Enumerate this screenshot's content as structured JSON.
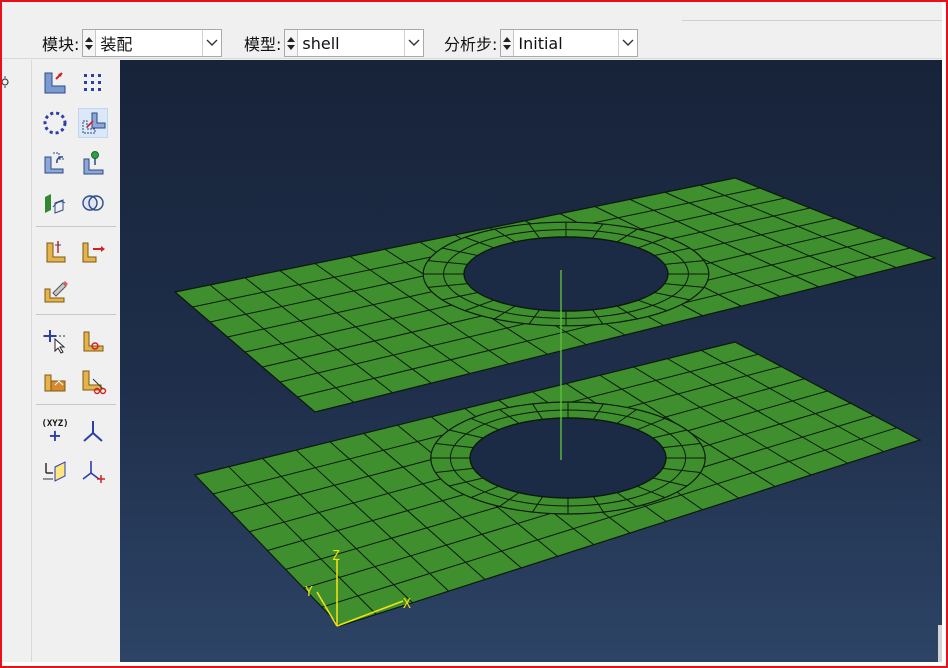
{
  "toolbar": {
    "module": {
      "label": "模块:",
      "value": "装配"
    },
    "model": {
      "label": "模型:",
      "value": "shell"
    },
    "step": {
      "label": "分析步:",
      "value": "Initial"
    }
  },
  "viewport": {
    "axis_labels": {
      "x": "X",
      "y": "Y",
      "z": "Z"
    }
  },
  "tools": [
    {
      "name": "instance-part-icon"
    },
    {
      "name": "linear-pattern-icon"
    },
    {
      "name": "radial-pattern-icon"
    },
    {
      "name": "translate-instance-icon"
    },
    {
      "name": "rotate-instance-icon"
    },
    {
      "name": "translate-to-icon"
    },
    {
      "name": "convert-constraints-icon"
    },
    {
      "name": "merge-cut-icon"
    },
    {
      "name": "parallel-face-icon"
    },
    {
      "name": "face-to-face-icon"
    },
    {
      "name": "edit-feature-icon"
    },
    {
      "name": "query-pick-icon"
    },
    {
      "name": "datum-point-icon"
    },
    {
      "name": "partition-cell-icon"
    },
    {
      "name": "cut-feature-icon"
    },
    {
      "name": "create-datum-xyz-icon",
      "label": "(XYZ)"
    },
    {
      "name": "datum-axis-icon"
    },
    {
      "name": "datum-plane-icon"
    },
    {
      "name": "datum-csys-icon"
    }
  ],
  "colors": {
    "frame": "#e8101a",
    "mesh_fill": "#3f8f2f",
    "mesh_edge": "#0b1a0b",
    "viewport_top": "#172339",
    "viewport_bottom": "#2d4466",
    "triad": "#f2e012"
  }
}
